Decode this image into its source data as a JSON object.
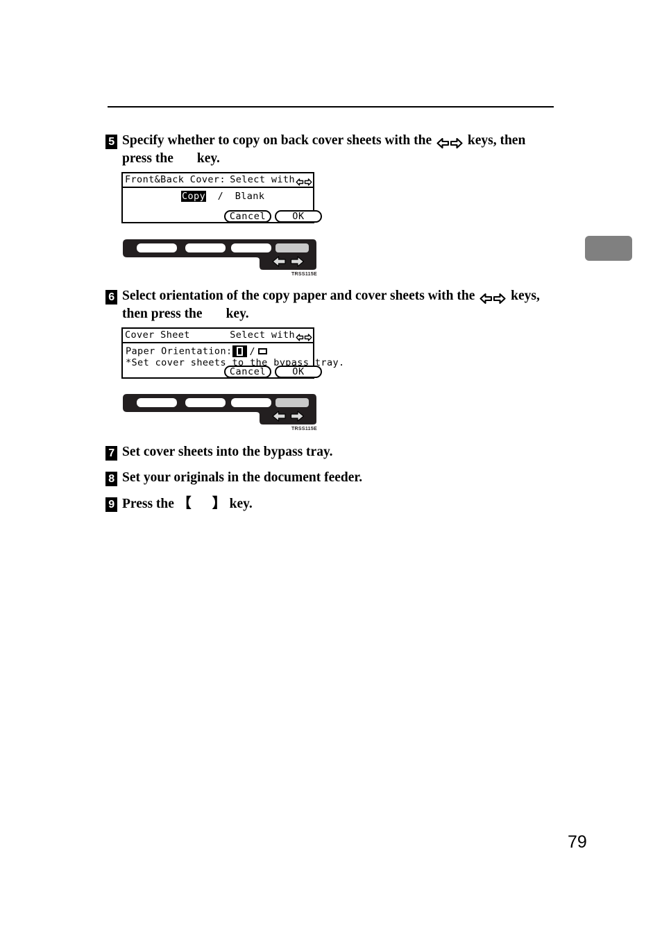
{
  "page": {
    "number": "79",
    "tab_marker_color": "#808080"
  },
  "steps": [
    {
      "number": "5",
      "line1_a": "Specify whether to copy on back cover sheets with the",
      "line1_b": "keys, then",
      "line2_a": "press the",
      "line2_b": "key."
    },
    {
      "number": "6",
      "line1_a": "Select orientation of the copy paper and cover sheets with the",
      "line1_b": "keys,",
      "line2_a": "then press the",
      "line2_b": "key."
    },
    {
      "number": "7",
      "line1_a": "Set cover sheets into the bypass tray.",
      "line1_b": "",
      "line2_a": "",
      "line2_b": ""
    },
    {
      "number": "8",
      "line1_a": "Set your originals in the document feeder.",
      "line1_b": "",
      "line2_a": "",
      "line2_b": ""
    },
    {
      "number": "9",
      "line1_a": "Press the",
      "line1_b": "key.",
      "line2_a": "",
      "line2_b": ""
    }
  ],
  "lcd_front_back_cover": {
    "title": "Front&Back Cover:",
    "select_with": "Select with",
    "option_selected": "Copy",
    "separator": "/",
    "option_other": "Blank",
    "cancel_label": "Cancel",
    "ok_label": "OK"
  },
  "lcd_cover_sheet": {
    "title": "Cover Sheet",
    "select_with": "Select with",
    "field_label": "Paper Orientation:",
    "separator": "/",
    "note": "*Set cover sheets to the bypass tray.",
    "cancel_label": "Cancel",
    "ok_label": "OK",
    "orientation_selected": "portrait-icon",
    "orientation_other": "landscape-icon"
  },
  "operation_panel_1": {
    "caption": "TRSS115E"
  },
  "operation_panel_2": {
    "caption": "TRSS115E"
  },
  "icons": {
    "left_arrow_key": "arrow-left-key-icon",
    "right_arrow_key": "arrow-right-key-icon"
  }
}
